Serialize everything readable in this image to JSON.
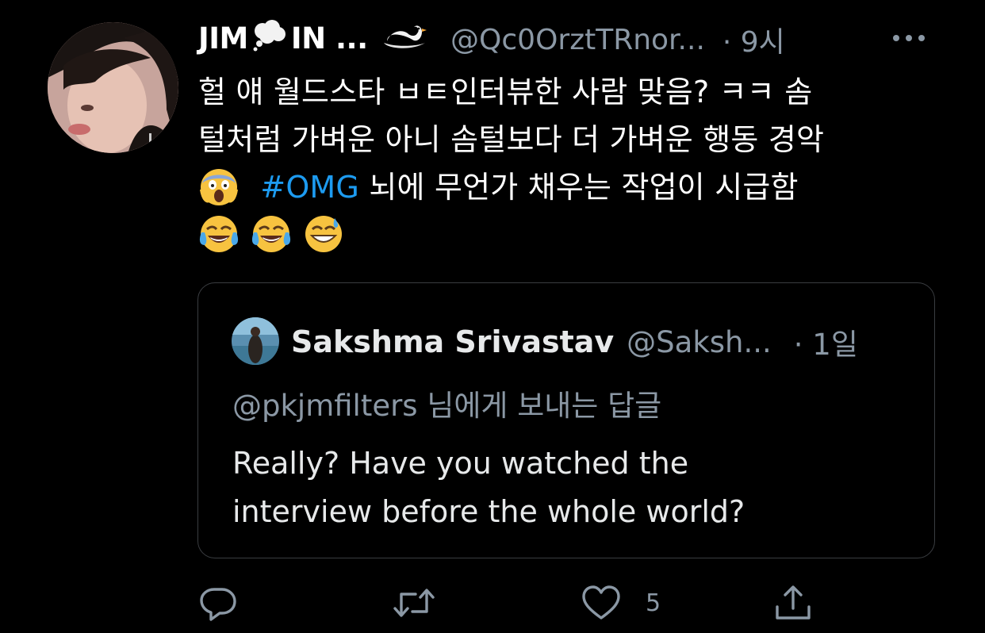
{
  "tweet": {
    "author": {
      "name_part1": "JIM",
      "name_part2": "IN ...",
      "handle": "@Qc0OrztTRnor...",
      "time": "· 9시",
      "name_emojis": [
        "thought-balloon-emoji",
        "swan-emoji"
      ]
    },
    "text_lines": [
      "헐 얘 월드스타 ㅂㅌ인터뷰한 사람 맞음? ㅋㅋ 솜",
      "털처럼 가벼운 아니 솜털보다 더 가벼운 행동 경악"
    ],
    "line3": {
      "emoji": "face-screaming-in-fear-emoji",
      "hashtag": "#OMG",
      "text": "뇌에 무언가 채우는 작업이 시급함"
    },
    "end_emojis": [
      "face-with-tears-of-joy-emoji",
      "face-with-tears-of-joy-emoji",
      "grinning-face-with-sweat-emoji"
    ]
  },
  "quoted_tweet": {
    "name": "Sakshma Srivastav",
    "handle": "@Saksh...",
    "time": "· 1일",
    "reply_to": "@pkjmfilters 님에게 보내는 답글",
    "text_lines": [
      "Really? Have you watched the",
      "interview before the whole world?"
    ]
  },
  "actions": {
    "like_count": "5",
    "icons": [
      "reply-icon",
      "retweet-icon",
      "like-icon",
      "share-icon"
    ]
  },
  "colors": {
    "background": "#000000",
    "text": "#ffffff",
    "secondary": "#8b98a5",
    "link": "#1d9bf0",
    "border": "#3a3d41"
  }
}
